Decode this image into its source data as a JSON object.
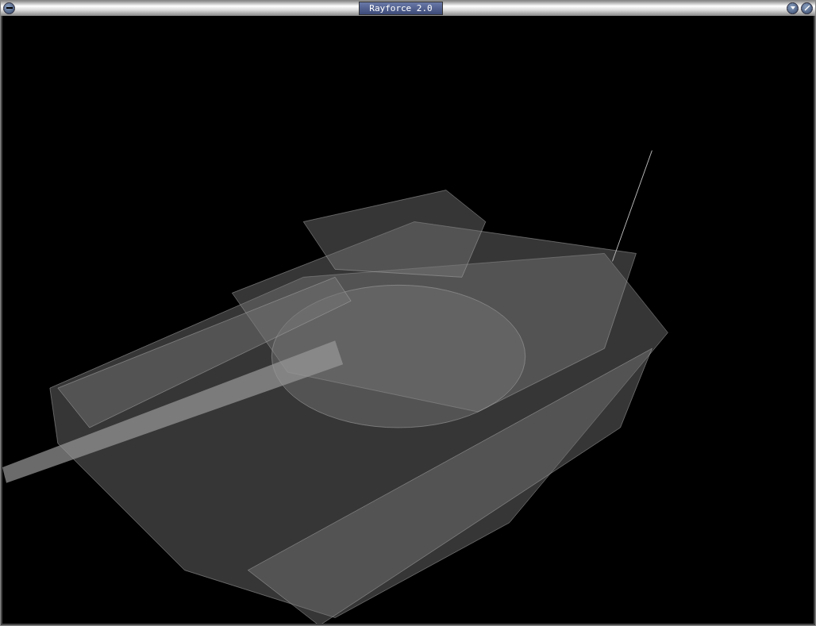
{
  "window": {
    "title": "Rayforce 2.0"
  }
}
